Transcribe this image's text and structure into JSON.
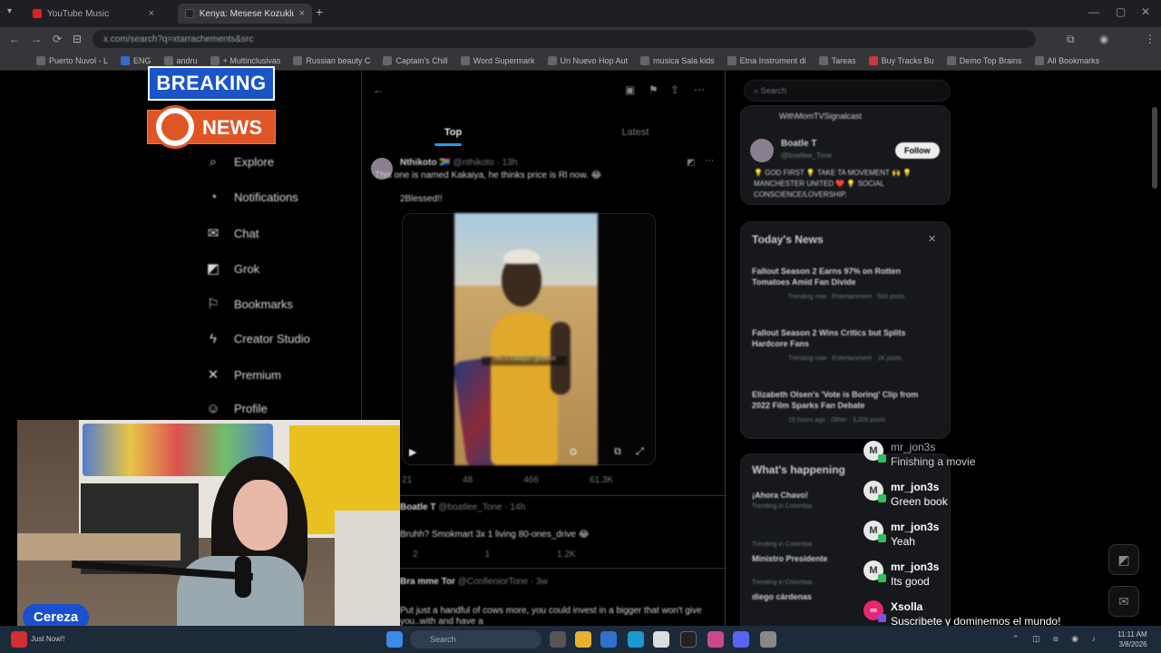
{
  "browser": {
    "tabs": [
      {
        "label": "YouTube Music",
        "active": false,
        "icon": "youtube-icon",
        "color": "#e02020"
      },
      {
        "label": "Kenya: Mesese Kozuklu",
        "active": true,
        "icon": "x-icon",
        "color": "#222222"
      }
    ],
    "url": "x.com/search?q=xtarrachements&src",
    "bookmarks": [
      "Puerto Nuvol - L",
      "ENG",
      "andru",
      "+ Multinclusivas",
      "Russian beauty C",
      "Captain's Chill",
      "Word Supermark",
      "Un Nuevo Hop Aut",
      "musica Sala kids",
      "Etna Instrument di",
      "Tareas",
      "Buy Tracks Bu",
      "Demo Top Brains",
      "All Bookmarks"
    ]
  },
  "overlay": {
    "breaking": "BREAKING",
    "news": "NEWS",
    "streamer_name": "Cereza"
  },
  "x": {
    "nav": [
      {
        "label": "Explore",
        "icon": "search-icon",
        "glyph": "⌕"
      },
      {
        "label": "Notifications",
        "icon": "bell-icon",
        "glyph": "🔔"
      },
      {
        "label": "Chat",
        "icon": "mail-icon",
        "glyph": "✉"
      },
      {
        "label": "Grok",
        "icon": "grok-icon",
        "glyph": "◩"
      },
      {
        "label": "Bookmarks",
        "icon": "bookmark-icon",
        "glyph": "🔖"
      },
      {
        "label": "Creator Studio",
        "icon": "bolt-icon",
        "glyph": "⚡"
      },
      {
        "label": "Premium",
        "icon": "x-logo-icon",
        "glyph": "✕"
      },
      {
        "label": "Profile",
        "icon": "person-icon",
        "glyph": "👤"
      }
    ],
    "tabs": {
      "top": "Top",
      "latest": "Latest"
    },
    "tweet1": {
      "author": "Nthikoto 🇿🇦",
      "handle": "@nthikoto · 13h",
      "text": "This one is named Kakaiya, he thinks price is Rl now. 😂",
      "subtext": "2Blessed!!",
      "video_caption": "This is Kakaiya's goldilock",
      "stats": [
        "21",
        "48",
        "466",
        "61.3K"
      ]
    },
    "tweet2": {
      "author": "Boatle T",
      "handle": "@boatlee_Tone · 14h",
      "text": "Bruhh? Smokmart 3x 1 living 80-ones_drive 😂",
      "stats": [
        "2",
        "1",
        "1.2K"
      ]
    },
    "tweet3": {
      "author": "Bra mme Tor",
      "handle": "@ConfieniorTone · 3w",
      "text": "Put just a handful of cows more, you could invest in a bigger that won't give",
      "subtext": "you..with and have a"
    },
    "right": {
      "search_placeholder": "Search",
      "who_to_follow": {
        "top_text": "WithMomTVSignalcast",
        "name": "Boatle T",
        "handle": "@boatlee_Tone",
        "follow_label": "Follow",
        "bio": "💡 GOD FIRST 💡 TAKE TA MOVEMENT 🙌 💡 MANCHESTER UNITED ❤️ 💡 SOCIAL CONSCIENCE/LOVERSHIP."
      },
      "todays_news": {
        "title": "Today's News",
        "items": [
          {
            "headline": "Fallout Season 2 Earns 97% on Rotten Tomatoes Amid Fan Divide",
            "meta": "Trending now · Entertainment · 583 posts"
          },
          {
            "headline": "Fallout Season 2 Wins Critics but Splits Hardcore Fans",
            "meta": "Trending now · Entertainment · 1K posts"
          },
          {
            "headline": "Elizabeth Olsen's 'Vote is Boring' Clip from 2022 Film Sparks Fan Debate",
            "meta": "15 hours ago · Other · 3,205 posts"
          }
        ]
      },
      "whats_happening": {
        "title": "What's happening",
        "items": [
          {
            "headline": "¡Ahora Chavo!",
            "meta": "Trending in Colombia"
          },
          {
            "headline": "Ministro Presidente",
            "meta": "Trending in Colombia"
          },
          {
            "headline": "diego cárdenas",
            "meta": "Trending in Colombia"
          }
        ]
      }
    }
  },
  "chat": [
    {
      "user": "mr_jon3s",
      "text": "Finishing a movie",
      "avatar": "M",
      "faded": true
    },
    {
      "user": "mr_jon3s",
      "text": "Green book",
      "avatar": "M",
      "faded": false
    },
    {
      "user": "mr_jon3s",
      "text": "Yeah",
      "avatar": "M",
      "faded": false
    },
    {
      "user": "mr_jon3s",
      "text": "Its good",
      "avatar": "M",
      "faded": false
    },
    {
      "user": "Xsolla",
      "text": "Suscribete y dominemos el mundo!",
      "avatar": "",
      "faded": false
    }
  ],
  "taskbar": {
    "search_placeholder": "Search",
    "time": "11:11 AM",
    "date": "3/8/2026",
    "weather": "Just Now!!"
  }
}
